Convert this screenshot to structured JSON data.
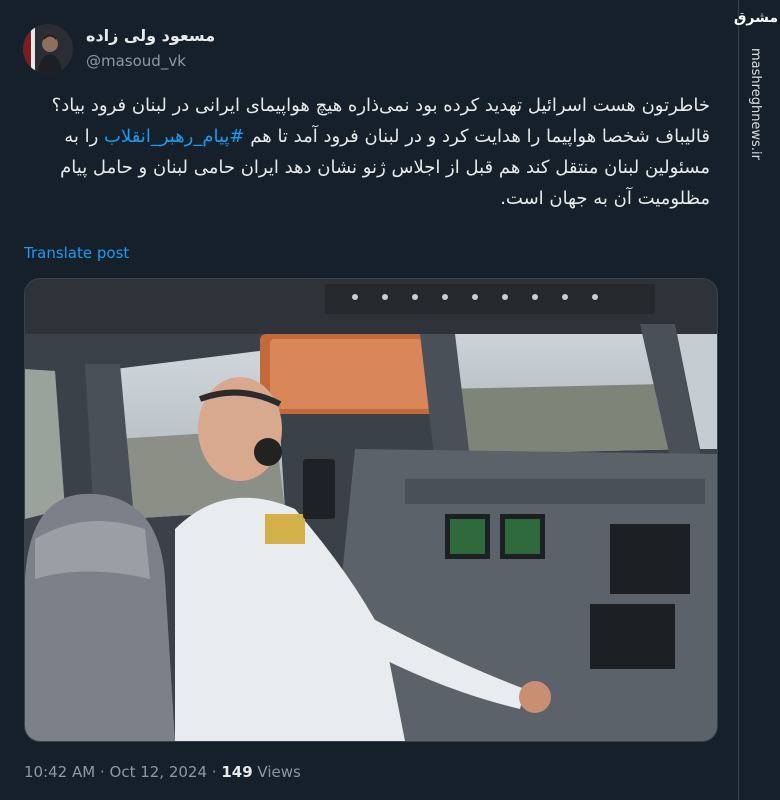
{
  "author": {
    "display_name": "مسعود ولی زاده",
    "handle": "@masoud_vk"
  },
  "post": {
    "paragraph1": "خاطرتون هست اسرائیل تهدید کرده بود نمی‌ذاره هیچ هواپیمای ایرانی در لبنان فرود بیاد؟",
    "paragraph2_before": "قالیباف شخصا هواپیما را هدایت کرد و در لبنان فرود آمد تا هم ",
    "hashtag": "#پیام_رهبر_انقلاب",
    "paragraph2_after": " را به مسئولین لبنان منتقل کند هم قبل از اجلاس ژنو نشان دهد ایران حامی لبنان و حامل پیام مظلومیت آن به جهان است.",
    "translate_label": "Translate post"
  },
  "meta": {
    "time": "10:42 AM",
    "separator": " · ",
    "date": "Oct 12, 2024",
    "views_count": "149",
    "views_label": " Views"
  },
  "watermark": {
    "logo": "مشرق",
    "vertical_text": "mashreghnews.ir"
  },
  "colors": {
    "background": "#15202b",
    "link": "#1d9bf0",
    "secondary_text": "#8b98a5"
  }
}
